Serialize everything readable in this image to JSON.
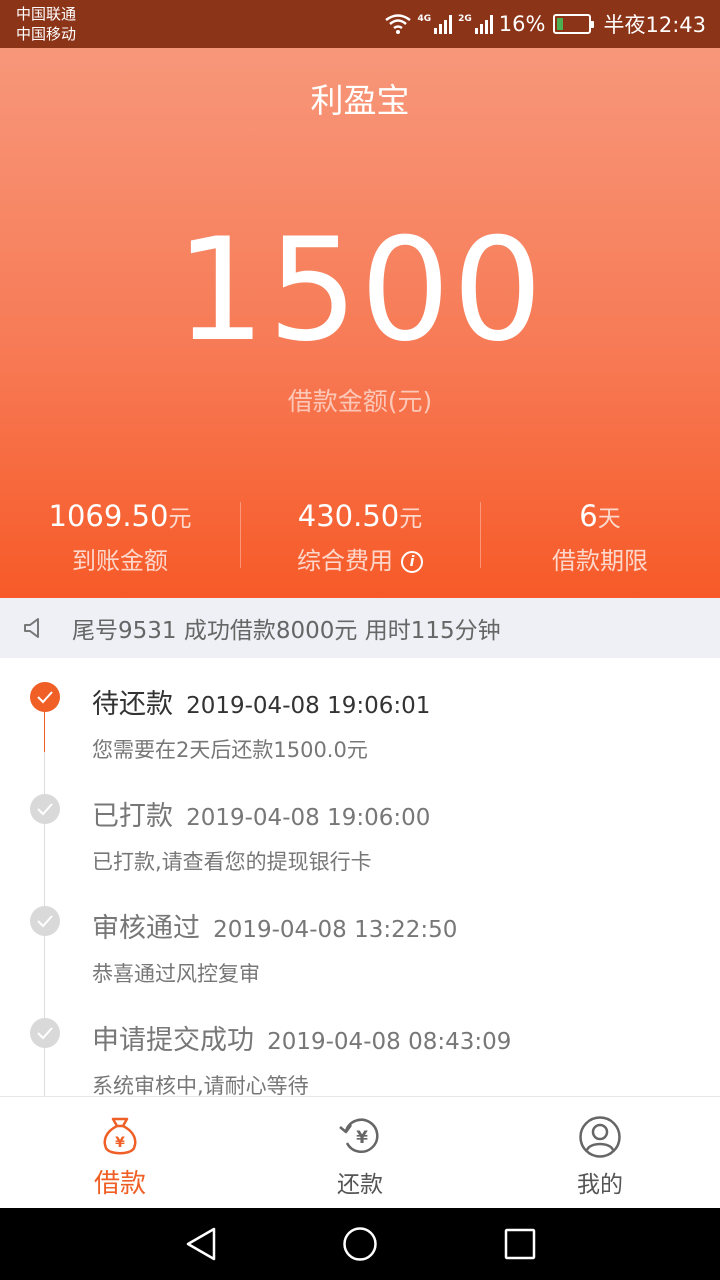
{
  "status_bar": {
    "carrier1": "中国联通",
    "carrier2": "中国移动",
    "network1": "4G",
    "network2": "2G",
    "battery": "16%",
    "time": "半夜12:43"
  },
  "header": {
    "title": "利盈宝"
  },
  "loan": {
    "amount": "1500",
    "amount_label": "借款金额(元)"
  },
  "stats": [
    {
      "value": "1069.50",
      "unit": "元",
      "label": "到账金额"
    },
    {
      "value": "430.50",
      "unit": "元",
      "label": "综合费用"
    },
    {
      "value": "6",
      "unit": "天",
      "label": "借款期限"
    }
  ],
  "notice": {
    "text": "尾号9531 成功借款8000元 用时115分钟",
    "icon": "speaker-icon"
  },
  "timeline": [
    {
      "title": "待还款",
      "time": "2019-04-08 19:06:01",
      "desc": "您需要在2天后还款1500.0元",
      "state": "current"
    },
    {
      "title": "已打款",
      "time": "2019-04-08 19:06:00",
      "desc": "已打款,请查看您的提现银行卡",
      "state": "done"
    },
    {
      "title": "审核通过",
      "time": "2019-04-08 13:22:50",
      "desc": "恭喜通过风控复审",
      "state": "done"
    },
    {
      "title": "申请提交成功",
      "time": "2019-04-08 08:43:09",
      "desc": "系统审核中,请耐心等待",
      "state": "done"
    }
  ],
  "tabbar": [
    {
      "label": "借款",
      "icon": "money-bag-icon",
      "active": true
    },
    {
      "label": "还款",
      "icon": "repay-icon",
      "active": false
    },
    {
      "label": "我的",
      "icon": "user-icon",
      "active": false
    }
  ],
  "colors": {
    "accent": "#ef5f26",
    "status_bar": "#8c3418"
  }
}
